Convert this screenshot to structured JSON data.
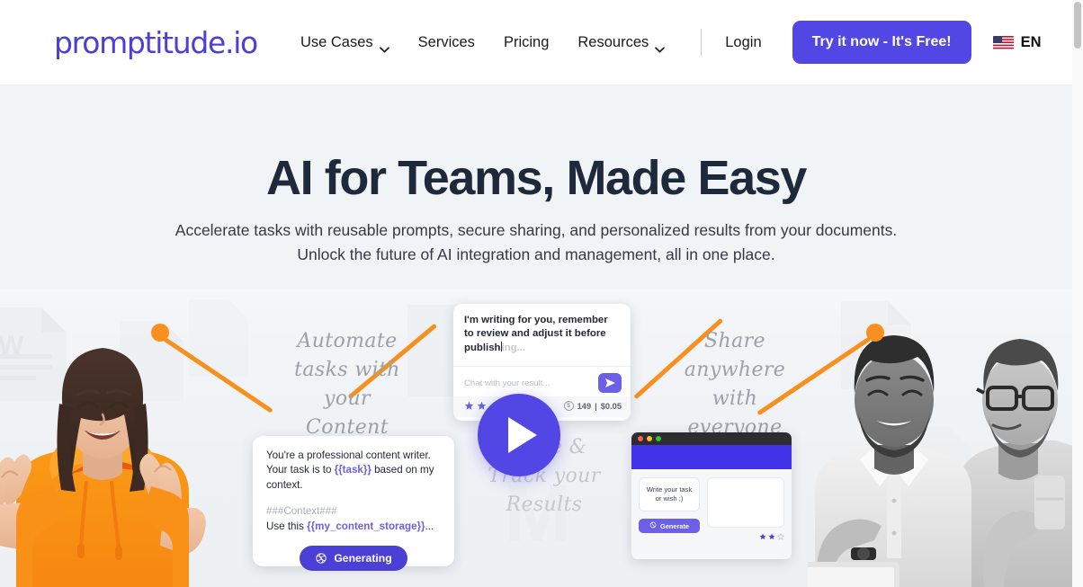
{
  "header": {
    "logo": {
      "text": "promptitude",
      "dot": ".",
      "suffix": "io"
    },
    "nav": [
      {
        "label": "Use Cases",
        "has_dropdown": true
      },
      {
        "label": "Services",
        "has_dropdown": false
      },
      {
        "label": "Pricing",
        "has_dropdown": false
      },
      {
        "label": "Resources",
        "has_dropdown": true
      }
    ],
    "login_label": "Login",
    "cta_label": "Try it now - It's Free!",
    "language": "EN",
    "accent_color": "#5246E5",
    "logo_color": "#4B3FD6"
  },
  "hero": {
    "title": "AI for Teams, Made Easy",
    "subtitle_line1": "Accelerate tasks with reusable prompts, secure sharing, and personalized results from your documents.",
    "subtitle_line2": "Unlock the future of AI integration and management, all in one place.",
    "background_color": "#F1F4F7",
    "title_color": "#1E293B"
  },
  "illustration": {
    "handwriting_left": "Automate\ntasks with\nyour Content",
    "handwriting_right": "Share\nanywhere\nwith everyone",
    "handwriting_center": "Share &\nTrack your\nResults",
    "connector_color": "#F7901E",
    "chat_card": {
      "message_typed": "I'm writing for you, remember to review and adjust it before publish",
      "message_ghost": "ing...",
      "input_placeholder": "Chat with your result...",
      "send_icon": "send-icon",
      "rating_stars": 2,
      "tokens": "149",
      "cost": "$0.05",
      "token_separator": "|"
    },
    "prompt_card": {
      "line1_a": "You're a professional content writer. Your task is to ",
      "line1_var": "{{task}}",
      "line1_b": " based on my context.",
      "context_header": "###Context###",
      "line2_a": "Use this ",
      "line2_var": "{{my_content_storage}}",
      "line2_b": "...",
      "button_label": "Generating",
      "button_icon": "openai-logo-icon"
    },
    "browser_mock": {
      "input_text": "Write your task or wish ;)",
      "button_label": "Generate",
      "button_icon": "openai-logo-icon",
      "traffic_lights": [
        "#FF5F57",
        "#FEBC2E",
        "#28C840"
      ],
      "header_color": "#4232E8",
      "stars_filled": 2,
      "stars_total": 3
    },
    "play_button": {
      "icon": "play-icon",
      "color": "#5246E5"
    }
  },
  "scrollbar": {
    "visible": true
  }
}
